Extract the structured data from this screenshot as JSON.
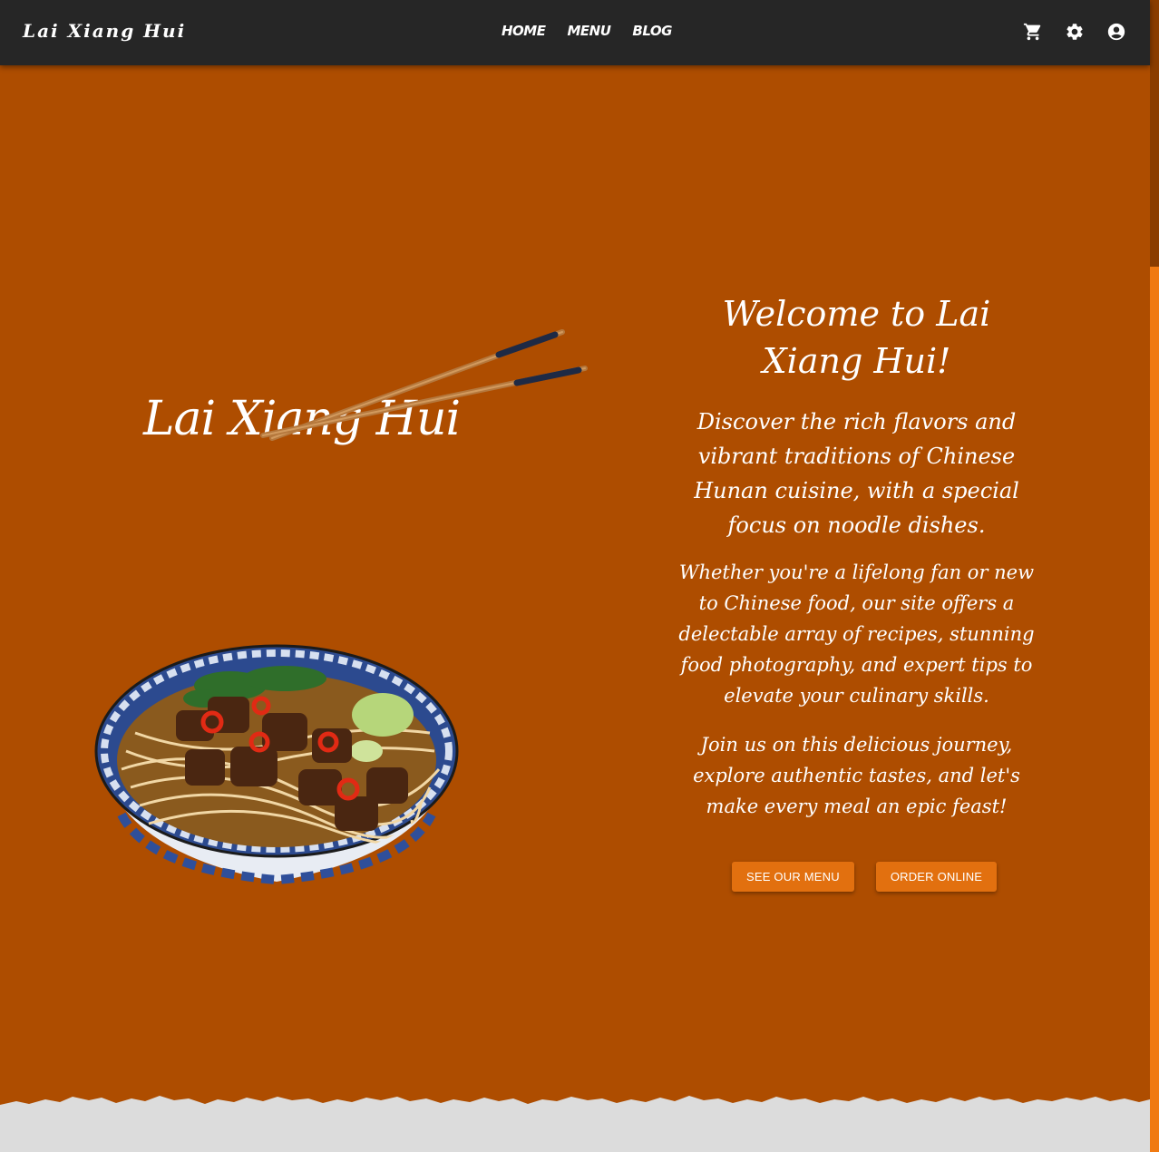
{
  "navbar": {
    "brand": "Lai Xiang Hui",
    "links": [
      "HOME",
      "MENU",
      "BLOG"
    ],
    "icons": [
      "cart-icon",
      "settings-icon",
      "account-icon"
    ]
  },
  "hero": {
    "logo_text": "Lai Xiang Hui",
    "title": "Welcome to Lai Xiang Hui!",
    "paragraph1": "Discover the rich flavors and vibrant traditions of Chinese Hunan cuisine, with a special focus on noodle dishes.",
    "paragraph2": "Whether you're a lifelong fan or new to Chinese food, our site offers a delectable array of recipes, stunning food photography, and expert tips to elevate your culinary skills.",
    "paragraph3": "Join us on this delicious journey, explore authentic tastes, and let's make every meal an epic feast!",
    "buttons": {
      "menu": "SEE OUR MENU",
      "order": "ORDER ONLINE"
    }
  },
  "colors": {
    "navbar": "#262626",
    "hero_background": "#ae4d00",
    "button": "#e2700f",
    "footer_paper": "#dcdcdc",
    "scrollbar_track": "#f07a12"
  }
}
